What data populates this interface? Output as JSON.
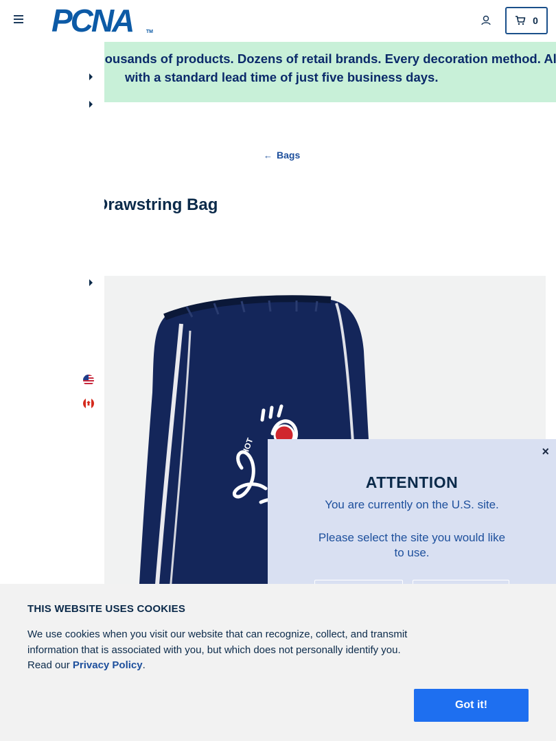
{
  "header": {
    "logo_text": "PCNA",
    "logo_tm": "TM",
    "cart_count": "0"
  },
  "banner": {
    "line1": "Thousands of products. Dozens of retail brands. Every decoration method. All",
    "line2": "with a standard lead time of just five business days."
  },
  "breadcrumb": {
    "arrow": "←",
    "label": "Bags"
  },
  "product": {
    "title": "Drawstring Bag"
  },
  "attention": {
    "close": "×",
    "heading": "ATTENTION",
    "current_site": "You are currently on the U.S. site.",
    "prompt": "Please select the site you would like to use."
  },
  "cookie": {
    "title": "THIS WEBSITE USES COOKIES",
    "text_before": "We use cookies when you visit our website that can recognize, collect, and transmit information that is associated with you, but which does not personally identify you. Read our ",
    "link": "Privacy Policy",
    "text_after": ".",
    "button": "Got it!"
  },
  "colors": {
    "brand_blue": "#0c5aa6",
    "banner_green": "#c8f0d8",
    "modal_bg": "#d9e0f2",
    "cookie_button": "#1e6ff0",
    "bag_navy": "#14265a"
  },
  "icons": [
    "menu-icon",
    "account-icon",
    "cart-icon",
    "us-flag-icon",
    "canada-flag-icon",
    "close-icon",
    "arrow-left-icon"
  ]
}
